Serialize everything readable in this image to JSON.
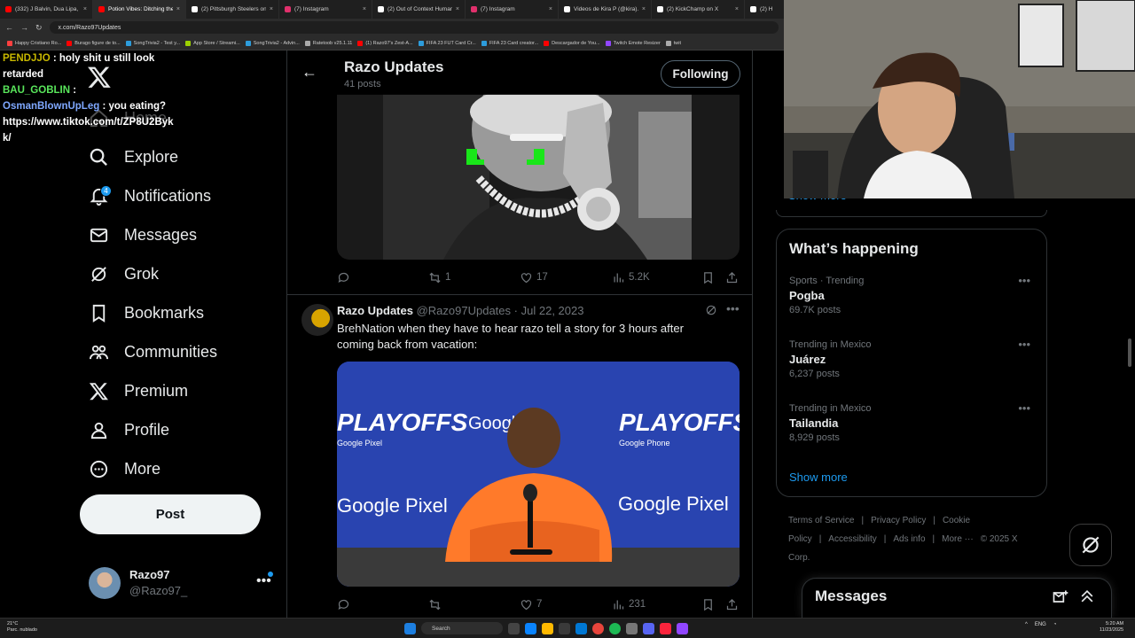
{
  "browser": {
    "tabs": [
      {
        "label": "(332) J Balvin, Dua Lipa, B...",
        "color": "#ff0000"
      },
      {
        "label": "Potion Vibes: Ditching the...",
        "color": "#ff0000"
      },
      {
        "label": "(2) Pittsburgh Steelers on...",
        "color": "#ffffff"
      },
      {
        "label": "(7) Instagram",
        "color": "#e1306c"
      },
      {
        "label": "(2) Out of Context Human...",
        "color": "#ffffff"
      },
      {
        "label": "(7) Instagram",
        "color": "#e1306c"
      },
      {
        "label": "Videos de Kira P (@kira)...",
        "color": "#ffffff"
      },
      {
        "label": "(2) KickChamp on X",
        "color": "#ffffff"
      },
      {
        "label": "(2) H",
        "color": "#ffffff"
      }
    ],
    "active_tab_label": "Razo Updates",
    "url": "x.com/Razo97Updates",
    "bookmarks": [
      {
        "label": "Happy Cristiano Ro...",
        "color": "#ff4040"
      },
      {
        "label": "Burago figure de to...",
        "color": "#ff0000"
      },
      {
        "label": "SongTrivia2 - Test y...",
        "color": "#2d9cdb"
      },
      {
        "label": "App Store / Streami...",
        "color": "#9bd000"
      },
      {
        "label": "SongTrivia2 - Advin...",
        "color": "#2d9cdb"
      },
      {
        "label": "Ratetoob v25.1.11",
        "color": "#aaaaaa"
      },
      {
        "label": "(1) Razo97's Zest-A...",
        "color": "#ff0000"
      },
      {
        "label": "FIFA 23 FUT Card Cr...",
        "color": "#2d9cdb"
      },
      {
        "label": "FIFA 23 Card creator...",
        "color": "#2d9cdb"
      },
      {
        "label": "Descargador de You...",
        "color": "#ff0000"
      },
      {
        "label": "Twitch Emote Resizer",
        "color": "#9146ff"
      },
      {
        "label": "twit",
        "color": "#aaaaaa"
      }
    ]
  },
  "chat": [
    {
      "user": "PENDJJO",
      "user_color": "#c8b800",
      "text": ": holy shit u still look"
    },
    {
      "user": "",
      "user_color": "#ffffff",
      "text": "retarded"
    },
    {
      "user": "BAU_GOBLIN",
      "user_color": "#59e65b",
      "text": ":"
    },
    {
      "user": "OsmanBlownUpLeg",
      "user_color": "#7fa8ff",
      "text": ": you eating?"
    },
    {
      "user": "",
      "user_color": "#ffffff",
      "text": "https://www.tiktok.com/t/ZP8U2Byk"
    },
    {
      "user": "",
      "user_color": "#ffffff",
      "text": "k/"
    }
  ],
  "sidebar": {
    "items": [
      {
        "label": "Home",
        "icon": "home-icon"
      },
      {
        "label": "Explore",
        "icon": "search-icon"
      },
      {
        "label": "Notifications",
        "icon": "bell-icon",
        "badge": "4"
      },
      {
        "label": "Messages",
        "icon": "envelope-icon"
      },
      {
        "label": "Grok",
        "icon": "grok-icon"
      },
      {
        "label": "Bookmarks",
        "icon": "bookmark-icon"
      },
      {
        "label": "Communities",
        "icon": "people-icon"
      },
      {
        "label": "Premium",
        "icon": "x-logo-icon"
      },
      {
        "label": "Profile",
        "icon": "person-icon"
      },
      {
        "label": "More",
        "icon": "more-circle-icon"
      }
    ],
    "post_label": "Post",
    "account": {
      "name": "Razo97",
      "handle": "@Razo97_"
    }
  },
  "header": {
    "title": "Razo Updates",
    "subtitle": "41 posts",
    "follow_label": "Following"
  },
  "tweet1": {
    "replies": "",
    "reposts": "1",
    "likes": "17",
    "views": "5.2K"
  },
  "tweet2": {
    "name": "Razo Updates",
    "handle": "@Razo97Updates",
    "sep": "·",
    "date": "Jul 22, 2023",
    "text": "BrehNation when they have to hear razo tell a story for 3 hours after coming back from vacation:",
    "media_labels": {
      "playoffs": "PLAYOFFS",
      "google_pixel": "Google Pixel",
      "google_phone": "Google Phone",
      "google": "Google"
    },
    "replies": "",
    "reposts": "",
    "likes": "7",
    "views": "231"
  },
  "trending": {
    "heading": "What’s happening",
    "items": [
      {
        "context": "Sports · Trending",
        "name": "Pogba",
        "count": "69.7K posts"
      },
      {
        "context": "Trending in Mexico",
        "name": "Juárez",
        "count": "6,237 posts"
      },
      {
        "context": "Trending in Mexico",
        "name": "Tailandia",
        "count": "8,929 posts"
      }
    ],
    "show_more": "Show more"
  },
  "right_above_fragment": "Show more",
  "footer": {
    "links": [
      "Terms of Service",
      "|",
      "Privacy Policy",
      "|",
      "Cookie Policy",
      "|",
      "Accessibility",
      "|",
      "Ads info",
      "|",
      "More ···",
      "© 2025 X Corp."
    ]
  },
  "messages_dock": {
    "title": "Messages"
  },
  "taskbar": {
    "temp": "21°C",
    "weather": "Parc. nublado",
    "search": "Search",
    "lang": "ENG",
    "time": "5:20 AM",
    "date": "11/23/2025"
  },
  "colors": {
    "accent": "#1d9bf0",
    "bg": "#000000",
    "border": "#2f3336",
    "muted": "#71767b"
  }
}
